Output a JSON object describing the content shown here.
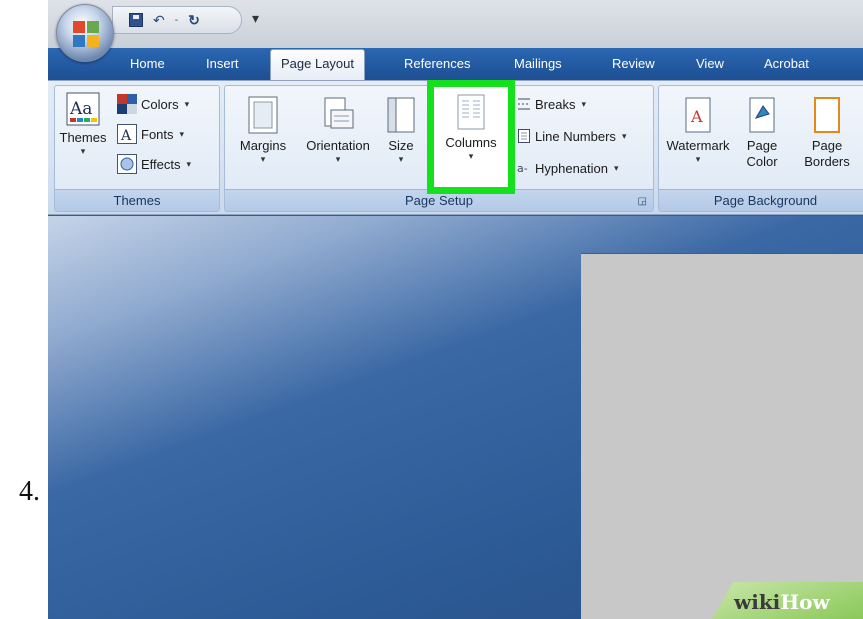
{
  "step": {
    "number": "4."
  },
  "quick_access": {
    "save_icon": "save-icon",
    "undo_icon": "undo-icon",
    "redo_icon": "redo-icon",
    "customize_icon": "customize-qat-icon"
  },
  "tabs": [
    {
      "label": "Home"
    },
    {
      "label": "Insert"
    },
    {
      "label": "Page Layout",
      "active": true
    },
    {
      "label": "References"
    },
    {
      "label": "Mailings"
    },
    {
      "label": "Review"
    },
    {
      "label": "View"
    },
    {
      "label": "Acrobat"
    }
  ],
  "ribbon": {
    "themes_group": {
      "label": "Themes",
      "themes_button": "Themes",
      "colors_button": "Colors",
      "fonts_button": "Fonts",
      "effects_button": "Effects"
    },
    "page_setup_group": {
      "label": "Page Setup",
      "margins": "Margins",
      "orientation": "Orientation",
      "size": "Size",
      "columns": "Columns",
      "breaks": "Breaks",
      "line_numbers": "Line Numbers",
      "hyphenation": "Hyphenation"
    },
    "page_background_group": {
      "label": "Page Background",
      "watermark": "Watermark",
      "page_color_line1": "Page",
      "page_color_line2": "Color",
      "page_borders_line1": "Page",
      "page_borders_line2": "Borders"
    },
    "dropdown_glyph": "▾"
  },
  "highlight_color": "#15e01c",
  "brand": {
    "wiki": "wiki",
    "how": "How"
  }
}
